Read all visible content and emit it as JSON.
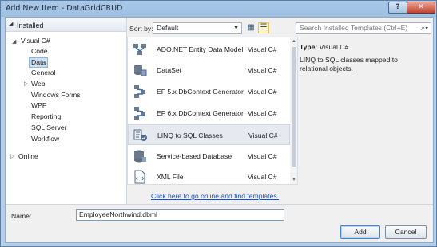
{
  "window": {
    "title": "Add New Item - DataGridCRUD",
    "help_label": "?",
    "close_label": "✕"
  },
  "tree": {
    "header": "Installed",
    "items": [
      {
        "label": "Visual C#",
        "level": 0,
        "expanded": true
      },
      {
        "label": "Code",
        "level": 1
      },
      {
        "label": "Data",
        "level": 1,
        "selected": true
      },
      {
        "label": "General",
        "level": 1
      },
      {
        "label": "Web",
        "level": 1,
        "collapsed": true
      },
      {
        "label": "Windows Forms",
        "level": 1
      },
      {
        "label": "WPF",
        "level": 1
      },
      {
        "label": "Reporting",
        "level": 1
      },
      {
        "label": "SQL Server",
        "level": 1
      },
      {
        "label": "Workflow",
        "level": 1
      }
    ],
    "online": "Online"
  },
  "sort": {
    "label": "Sort by:",
    "value": "Default"
  },
  "search": {
    "placeholder": "Search Installed Templates (Ctrl+E)"
  },
  "templates": [
    {
      "name": "ADO.NET Entity Data Model",
      "lang": "Visual C#",
      "icon": "entity-model-icon"
    },
    {
      "name": "DataSet",
      "lang": "Visual C#",
      "icon": "dataset-icon"
    },
    {
      "name": "EF 5.x DbContext Generator",
      "lang": "Visual C#",
      "icon": "dbcontext-generator-icon"
    },
    {
      "name": "EF 6.x DbContext Generator",
      "lang": "Visual C#",
      "icon": "dbcontext-generator-icon"
    },
    {
      "name": "LINQ to SQL Classes",
      "lang": "Visual C#",
      "icon": "linq-to-sql-icon",
      "selected": true
    },
    {
      "name": "Service-based Database",
      "lang": "Visual C#",
      "icon": "database-icon"
    },
    {
      "name": "XML File",
      "lang": "Visual C#",
      "icon": "xml-file-icon"
    }
  ],
  "online_link": "Click here to go online and find templates.",
  "details": {
    "type_label": "Type:",
    "type_value": "Visual C#",
    "description": "LINQ to SQL classes mapped to relational objects."
  },
  "name_field": {
    "label": "Name:",
    "value": "EmployeeNorthwind.dbml"
  },
  "buttons": {
    "add": "Add",
    "cancel": "Cancel"
  }
}
